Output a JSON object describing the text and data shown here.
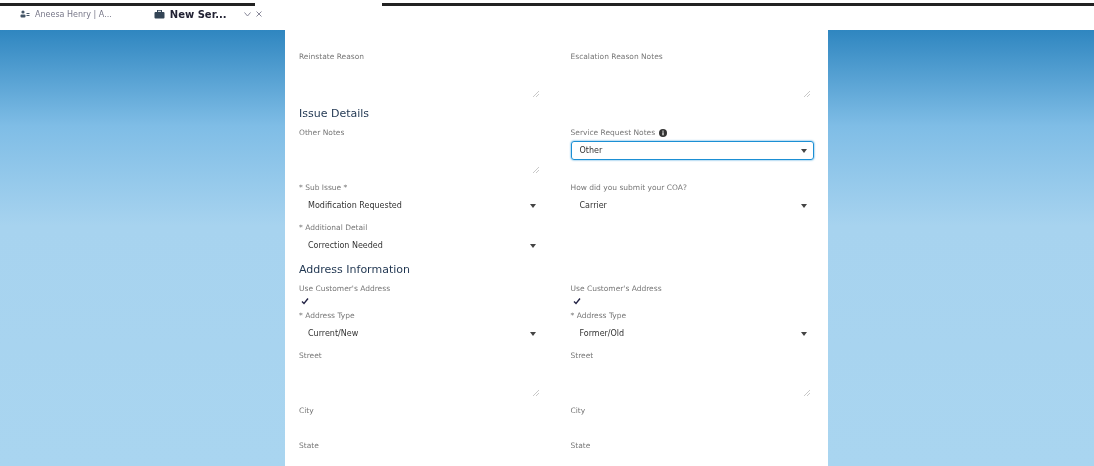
{
  "tabs": [
    {
      "label": "Aneesa Henry | A...",
      "kind": "person",
      "selected": false,
      "closable": false
    },
    {
      "label": "New Ser...",
      "kind": "case",
      "selected": true,
      "closable": true
    }
  ],
  "sections": [
    {
      "rows": [
        {
          "left": {
            "kind": "textarea",
            "label": "Reinstate Reason"
          },
          "right": {
            "kind": "textarea",
            "label": "Escalation Reason Notes"
          }
        }
      ]
    },
    {
      "heading": "Issue Details",
      "rows": [
        {
          "left": {
            "kind": "textarea",
            "label": "Other Notes"
          },
          "right": {
            "kind": "select",
            "label": "Service Request Notes",
            "value": "Other",
            "focused": true,
            "info": true
          }
        },
        {
          "left": {
            "kind": "select",
            "label": "* Sub Issue *",
            "value": "Modification Requested",
            "focused": false
          },
          "right": {
            "kind": "select",
            "label": "How did you submit your COA?",
            "value": "Carrier",
            "focused": false
          }
        },
        {
          "left": {
            "kind": "select",
            "label": "* Additional Detail",
            "value": "Correction Needed",
            "focused": false
          },
          "right": null
        }
      ]
    },
    {
      "heading": "Address Information",
      "rows": [
        {
          "left": {
            "kind": "checkbox",
            "label": "Use Customer's Address",
            "checked": true
          },
          "right": {
            "kind": "checkbox",
            "label": "Use Customer's Address",
            "checked": true
          }
        },
        {
          "left": {
            "kind": "select",
            "label": "* Address Type",
            "value": "Current/New",
            "focused": false
          },
          "right": {
            "kind": "select",
            "label": "* Address Type",
            "value": "Former/Old",
            "focused": false
          }
        },
        {
          "left": {
            "kind": "textarea",
            "label": "Street"
          },
          "right": {
            "kind": "textarea",
            "label": "Street"
          }
        },
        {
          "left": {
            "kind": "text",
            "label": "City"
          },
          "right": {
            "kind": "text",
            "label": "City"
          }
        },
        {
          "left": {
            "kind": "text",
            "label": "State"
          },
          "right": {
            "kind": "text",
            "label": "State"
          }
        }
      ]
    }
  ]
}
